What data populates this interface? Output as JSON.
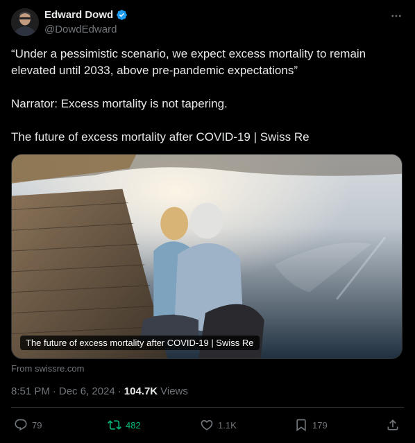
{
  "author": {
    "display_name": "Edward Dowd",
    "handle": "@DowdEdward",
    "verified": true
  },
  "more_icon": "more-horizontal-icon",
  "tweet": {
    "paragraphs": [
      "“Under a pessimistic scenario, we expect excess mortality to remain elevated until 2033, above pre-pandemic expectations”",
      "Narrator: Excess mortality is not tapering.",
      "The future of excess mortality after COVID-19 | Swiss Re"
    ]
  },
  "card": {
    "caption": "The future of excess mortality after COVID-19 | Swiss Re",
    "source": "From swissre.com"
  },
  "meta": {
    "time": "8:51 PM",
    "separator": "·",
    "date": "Dec 6, 2024",
    "separator2": "·",
    "views_count": "104.7K",
    "views_label": "Views"
  },
  "actions": {
    "replies": "79",
    "reposts": "482",
    "likes": "1.1K",
    "bookmarks": "179"
  },
  "colors": {
    "background": "#000000",
    "text": "#e7e9ea",
    "muted": "#71767b",
    "verified": "#1d9bf0",
    "repost_active": "#00ba7c",
    "border": "#2f3336"
  }
}
